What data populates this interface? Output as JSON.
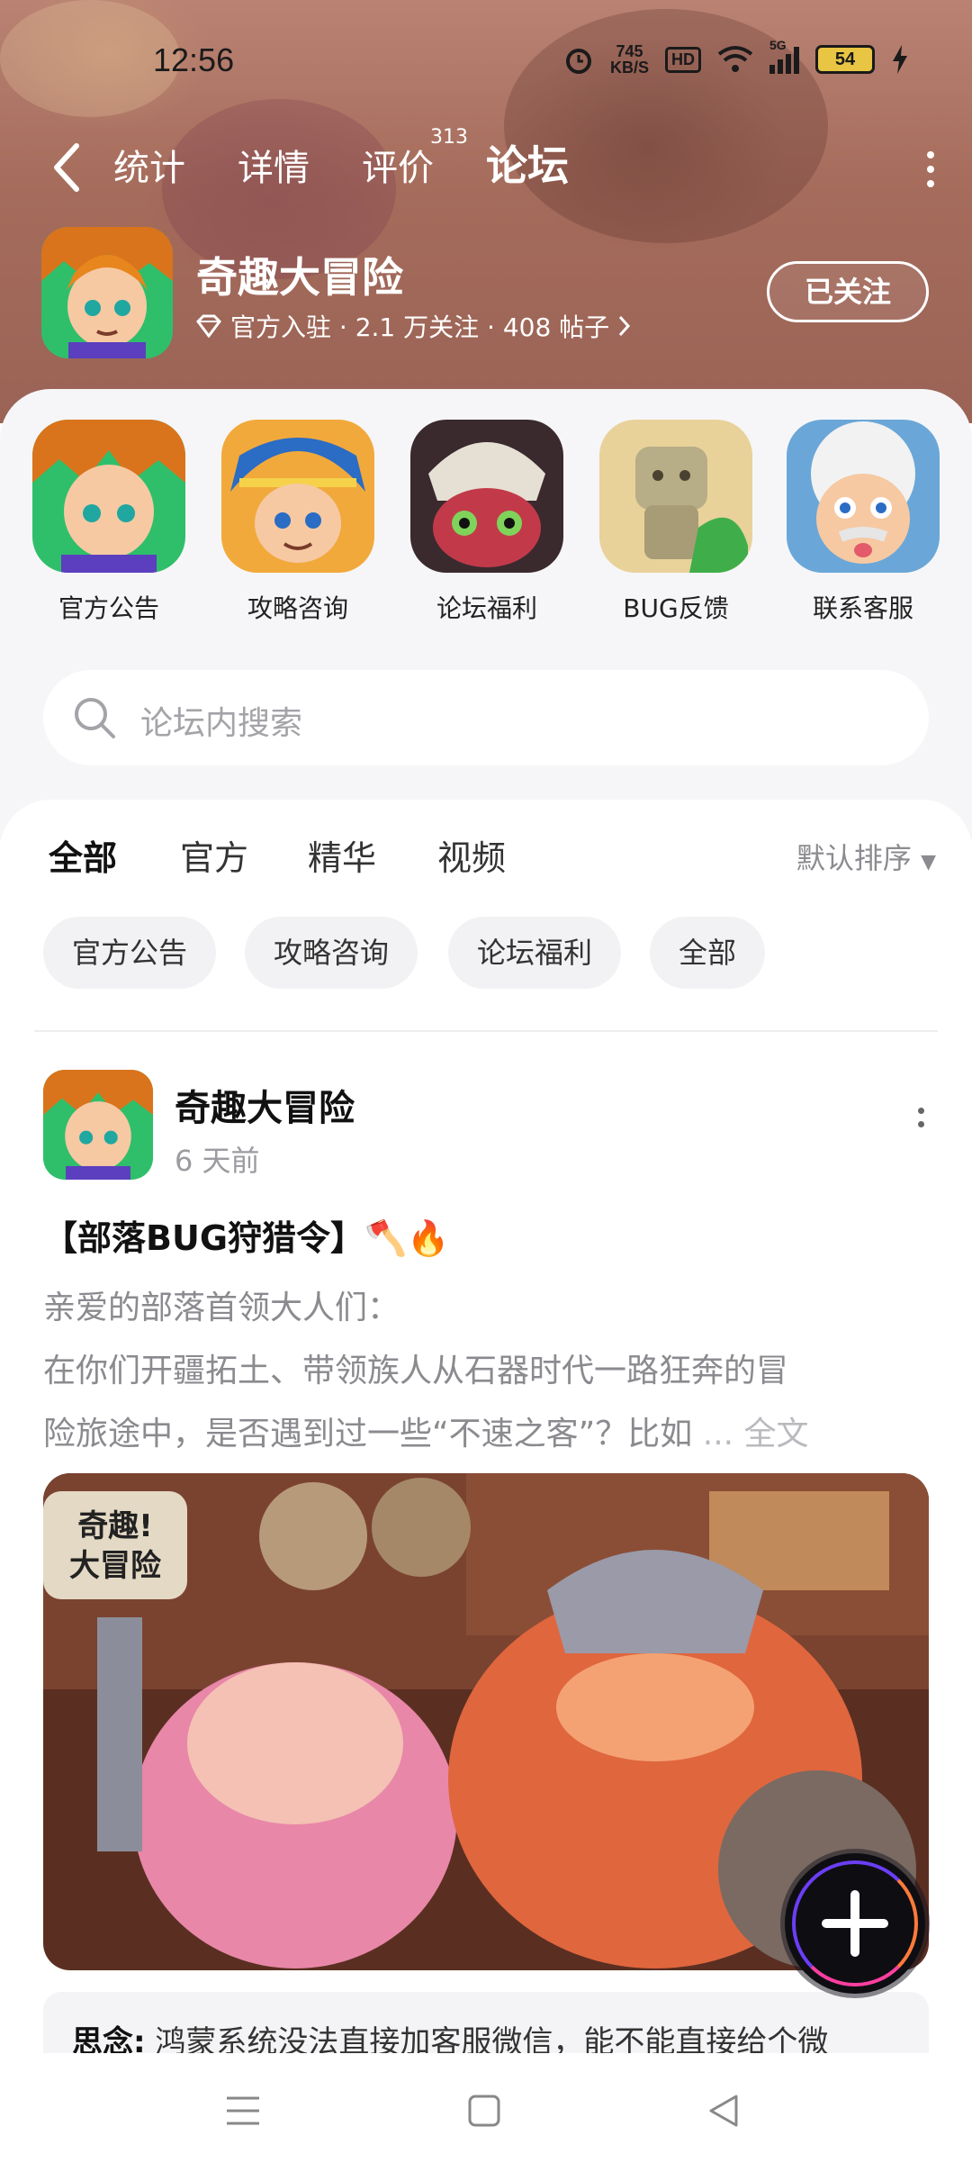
{
  "status_bar": {
    "time": "12:56",
    "net_speed_value": "745",
    "net_speed_unit": "KB/S",
    "hd": "HD",
    "signal_label": "5G",
    "battery": "54"
  },
  "nav": {
    "tabs": [
      {
        "label": "统计"
      },
      {
        "label": "详情"
      },
      {
        "label": "评价"
      },
      {
        "label": "论坛"
      }
    ],
    "review_count": "313",
    "active_tab": "论坛"
  },
  "game": {
    "name": "奇趣大冒险",
    "meta": "官方入驻 · 2.1 万关注 · 408 帖子",
    "follow_label": "已关注"
  },
  "categories": [
    {
      "label": "官方公告"
    },
    {
      "label": "攻略咨询"
    },
    {
      "label": "论坛福利"
    },
    {
      "label": "BUG反馈"
    },
    {
      "label": "联系客服"
    }
  ],
  "search": {
    "placeholder": "论坛内搜索"
  },
  "filter_tabs": [
    {
      "label": "全部"
    },
    {
      "label": "官方"
    },
    {
      "label": "精华"
    },
    {
      "label": "视频"
    }
  ],
  "sort_label": "默认排序",
  "chips": [
    {
      "label": "官方公告"
    },
    {
      "label": "攻略咨询"
    },
    {
      "label": "论坛福利"
    },
    {
      "label": "全部"
    }
  ],
  "post": {
    "author": "奇趣大冒险",
    "time": "6 天前",
    "title": "【部落BUG狩猎令】🪓🔥",
    "body_line1": "亲爱的部落首领大人们：",
    "body_line2": "在你们开疆拓土、带领族人从石器时代一路狂奔的冒",
    "body_line3": "险旅途中，是否遇到过一些“不速之客”？比如",
    "ellipsis": "... 全文",
    "image_logo_line1": "奇趣!",
    "image_logo_line2": "大冒险",
    "comment_author": "思念:",
    "comment_text": "鸿蒙系统没法直接加客服微信，能不能直接给个微"
  },
  "colors": {
    "accent": "#22d3c5",
    "hero_bg": "#a56c5c"
  }
}
